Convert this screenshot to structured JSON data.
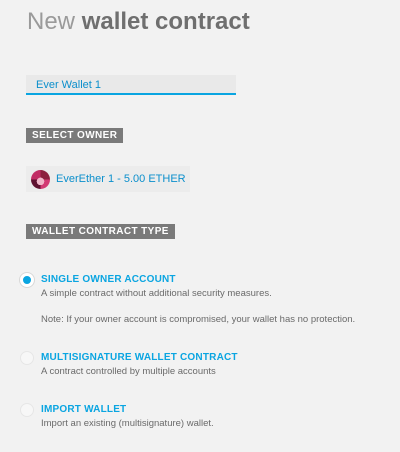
{
  "header": {
    "title_light": "New",
    "title_bold": "wallet contract"
  },
  "wallet_name": {
    "value": "Ever Wallet 1"
  },
  "owner_section": {
    "label": "SELECT OWNER",
    "selected_owner": "EverEther 1 - 5.00 ETHER",
    "avatar_icon": "identicon-avatar"
  },
  "type_section": {
    "label": "WALLET CONTRACT TYPE",
    "options": [
      {
        "title": "SINGLE OWNER ACCOUNT",
        "description": "A simple contract without additional security measures.",
        "note": "Note: If your owner account is compromised, your wallet has no protection.",
        "selected": true
      },
      {
        "title": "MULTISIGNATURE WALLET CONTRACT",
        "description": "A contract controlled by multiple accounts",
        "selected": false
      },
      {
        "title": "IMPORT WALLET",
        "description": "Import an existing (multisignature) wallet.",
        "selected": false
      }
    ]
  },
  "colors": {
    "accent": "#0aa5e1",
    "label_bg": "#7a7a7a",
    "background": "#f2f2f2"
  }
}
